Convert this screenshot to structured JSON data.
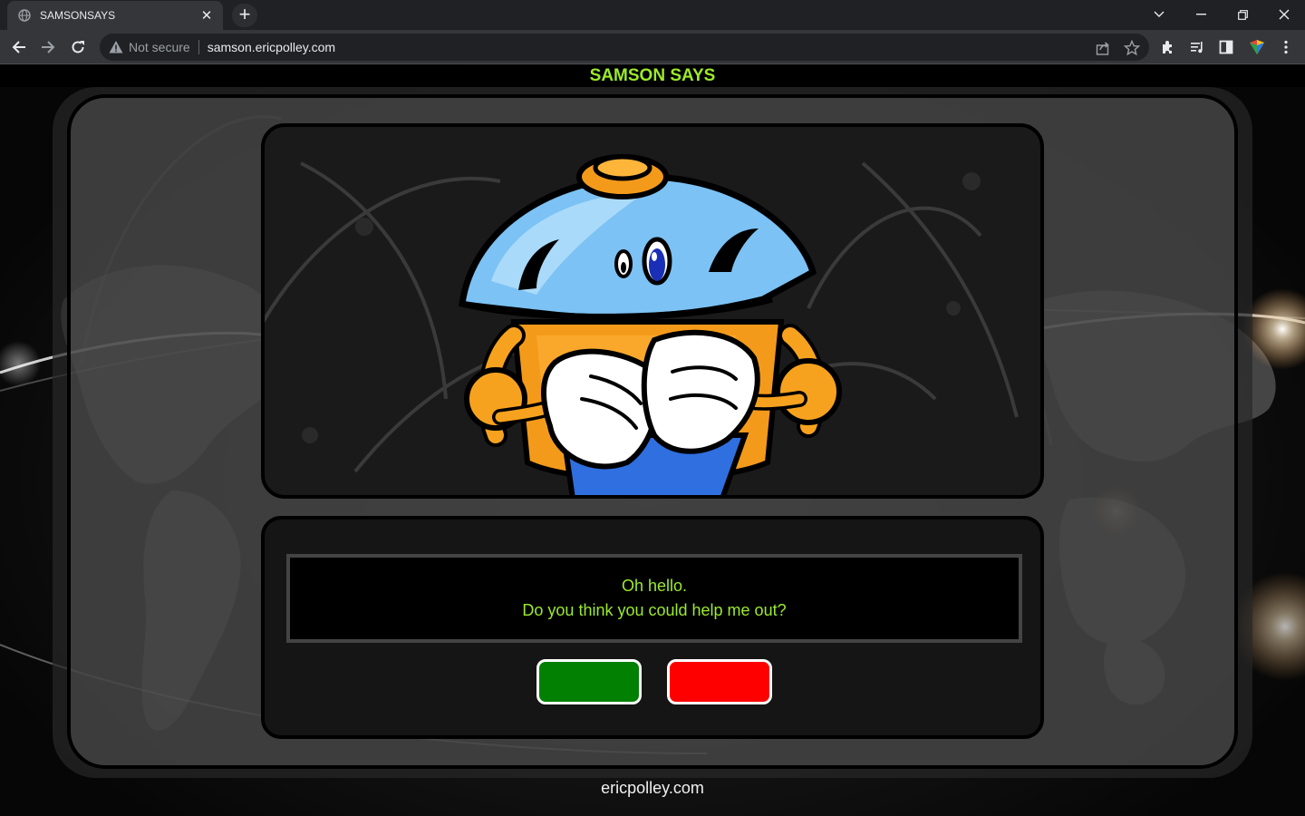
{
  "browser": {
    "tab": {
      "title": "SAMSONSAYS",
      "close_glyph": "✕",
      "icon": "globe-icon"
    },
    "new_tab_glyph": "+",
    "window_controls": [
      "tab-search-icon",
      "minimize-icon",
      "restore-icon",
      "close-icon"
    ],
    "security_label": "Not secure",
    "url": "samson.ericpolley.com",
    "toolbar_icons": [
      "back-icon",
      "forward-icon",
      "reload-icon",
      "share-icon",
      "star-icon",
      "extensions-icon",
      "media-icon",
      "sidepanel-icon",
      "profile-icon",
      "menu-icon"
    ]
  },
  "page": {
    "title": "SAMSON SAYS",
    "message": {
      "line1": "Oh hello.",
      "line2": "Do you think you could help me out?"
    },
    "buttons": {
      "yes_color": "#028002",
      "no_color": "#ff0000"
    },
    "footer": "ericpolley.com",
    "colors": {
      "accent": "#9cea2a",
      "background": "#000000"
    }
  }
}
